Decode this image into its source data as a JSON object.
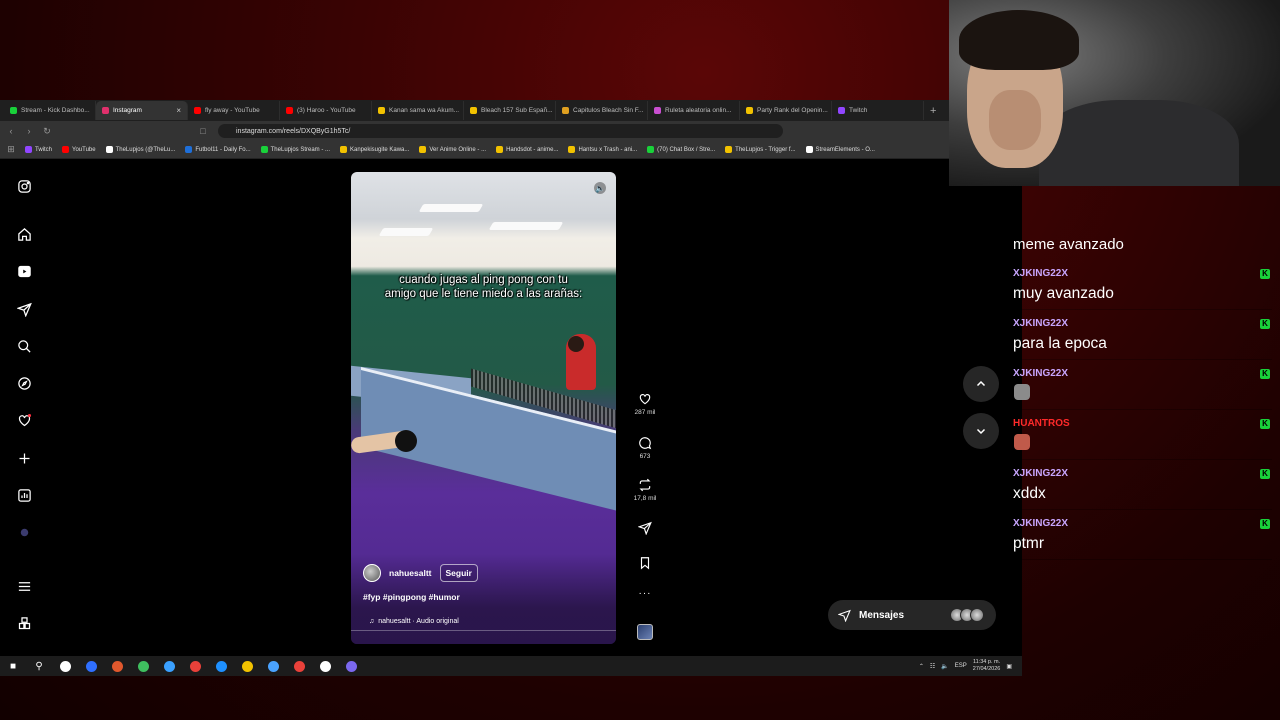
{
  "browser": {
    "tabs": [
      {
        "label": "Stream - Kick Dashbo...",
        "color": "#19d13a"
      },
      {
        "label": "Instagram",
        "color": "#e1306c",
        "active": true
      },
      {
        "label": "fly away - YouTube",
        "color": "#ff0000"
      },
      {
        "label": "(3) Haroo - YouTube",
        "color": "#ff0000"
      },
      {
        "label": "Kanan sama wa Akum...",
        "color": "#f2c200"
      },
      {
        "label": "Bleach 157 Sub Españ...",
        "color": "#f2c200"
      },
      {
        "label": "Capitulos Bleach Sin F...",
        "color": "#e0a020"
      },
      {
        "label": "Ruleta aleatoria onlin...",
        "color": "#c94fd1"
      },
      {
        "label": "Party Rank del Openin...",
        "color": "#f2c200"
      },
      {
        "label": "Twitch",
        "color": "#9146ff"
      }
    ],
    "close_tab_glyph": "×",
    "new_tab_glyph": "+",
    "url": "instagram.com/reels/DXQByG1h5Tc/",
    "bookmarks": [
      {
        "label": "Twitch",
        "color": "#9146ff"
      },
      {
        "label": "YouTube",
        "color": "#ff0000"
      },
      {
        "label": "TheLupjos (@TheLu...",
        "color": "#ffffff"
      },
      {
        "label": "Futbol11 - Daily Fo...",
        "color": "#1e6fd9"
      },
      {
        "label": "TheLupjos Stream - ...",
        "color": "#19d13a"
      },
      {
        "label": "Kanpekisugite Kawa...",
        "color": "#f2c200"
      },
      {
        "label": "Ver Anime Online - ...",
        "color": "#f2c200"
      },
      {
        "label": "Handsdot - anime...",
        "color": "#f2c200"
      },
      {
        "label": "Hantsu x Trash - ani...",
        "color": "#f2c200"
      },
      {
        "label": "(70) Chat Box / Stre...",
        "color": "#19d13a"
      },
      {
        "label": "TheLupjos - Trigger f...",
        "color": "#f2c200"
      },
      {
        "label": "StreamElements - O...",
        "color": "#ffffff"
      }
    ]
  },
  "instagram": {
    "sidebar_icons": [
      "instagram-logo-icon",
      "home-icon",
      "reels-icon",
      "send-icon",
      "search-icon",
      "explore-icon",
      "heart-icon",
      "create-icon",
      "dashboard-icon",
      "profile-icon",
      "menu-icon",
      "also-from-meta-icon"
    ],
    "reel": {
      "caption_line1": "cuando jugas al ping pong con tu",
      "caption_line2": "amigo que le tiene miedo a las arañas:",
      "username": "nahuesaltt",
      "follow_label": "Seguir",
      "hashtags": "#fyp #pingpong #humor",
      "audio": "nahuesaltt · Audio original",
      "mute_glyph": "🔈"
    },
    "actions": {
      "likes": "287 mil",
      "comments": "673",
      "reposts": "17,8 mil",
      "more_glyph": "···"
    },
    "messages_label": "Mensajes"
  },
  "chat": {
    "top_text": "meme avanzado",
    "messages": [
      {
        "user": "XJKING22X",
        "user_color": "#c9a6ff",
        "text": "muy avanzado"
      },
      {
        "user": "XJKING22X",
        "user_color": "#c9a6ff",
        "text": "para la epoca"
      },
      {
        "user": "XJKING22X",
        "user_color": "#c9a6ff",
        "text": "",
        "emote": "#8b8b8b"
      },
      {
        "user": "HUANTROS",
        "user_color": "#ff2a2a",
        "text": "",
        "emote": "#c05a4a"
      },
      {
        "user": "XJKING22X",
        "user_color": "#c9a6ff",
        "text": "xddx"
      },
      {
        "user": "XJKING22X",
        "user_color": "#c9a6ff",
        "text": "ptmr"
      }
    ],
    "badge_glyph": "K"
  },
  "taskbar": {
    "apps": [
      "#ffffff",
      "#2f6fff",
      "#e0582d",
      "#3fbf5f",
      "#3aa0ff",
      "#e9413a",
      "#1e90ff",
      "#f2c200",
      "#4aa3ff",
      "#e9413a",
      "#ffffff",
      "#7b68ee"
    ],
    "language": "ESP",
    "time": "11:34 p. m.",
    "date": "27/04/2026"
  }
}
